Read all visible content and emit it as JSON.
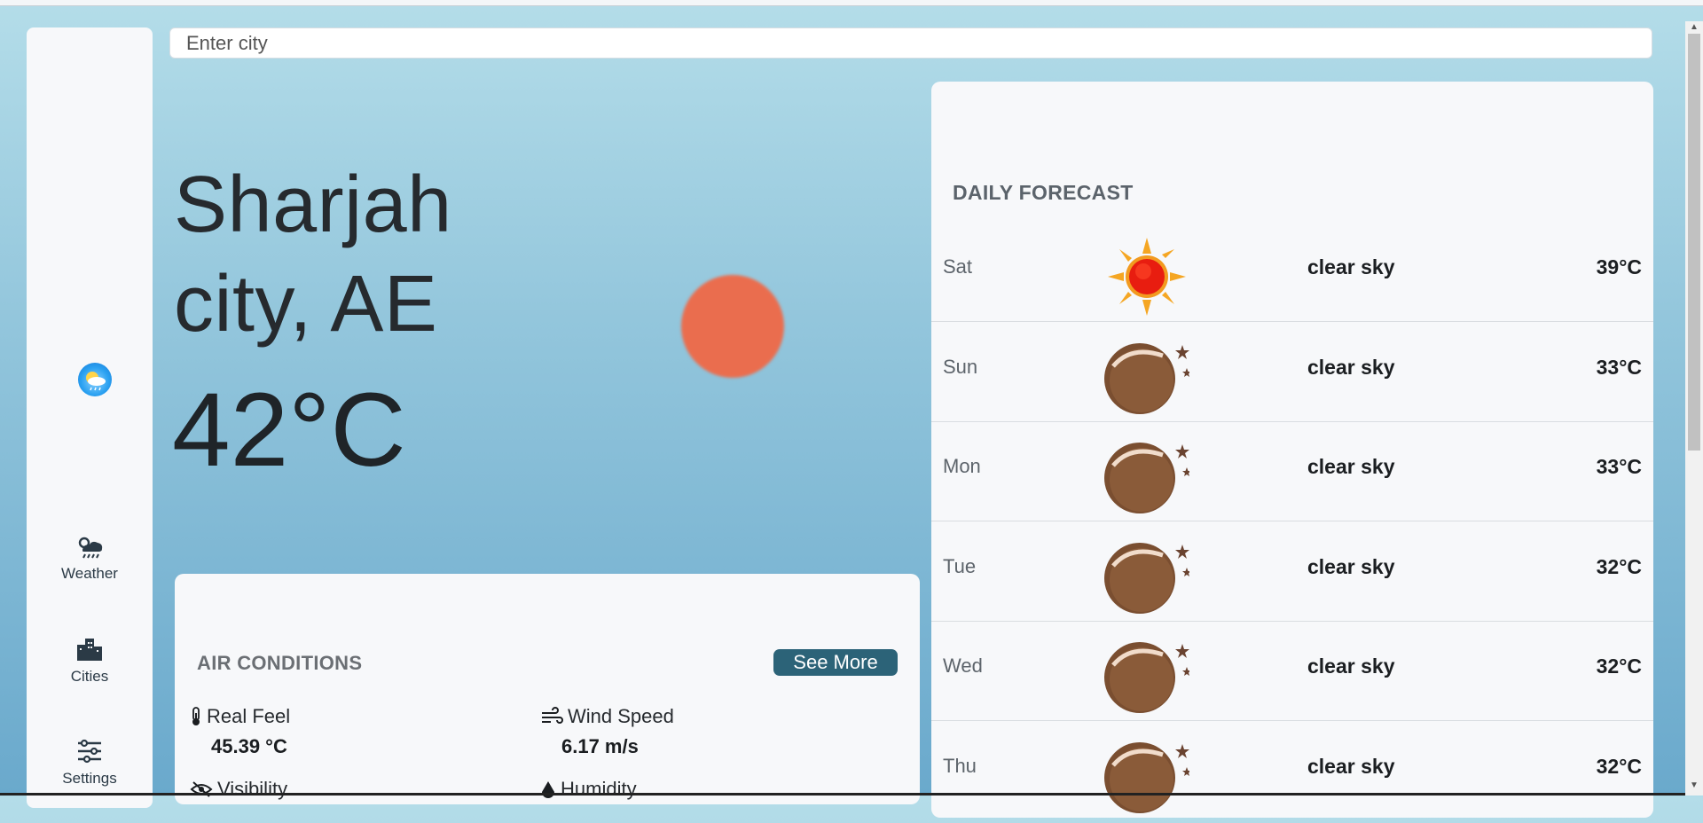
{
  "search": {
    "placeholder": "Enter city"
  },
  "current": {
    "city_line1": "Sharjah",
    "city_line2": "city, AE",
    "temperature": "42°C"
  },
  "sidebar": {
    "items": [
      {
        "label": "Weather",
        "icon": "weather-icon"
      },
      {
        "label": "Cities",
        "icon": "cities-icon"
      },
      {
        "label": "Settings",
        "icon": "settings-icon"
      }
    ]
  },
  "air": {
    "title": "AIR CONDITIONS",
    "see_more": "See More",
    "metrics": [
      {
        "label": "Real Feel",
        "value": "45.39 °C",
        "icon": "thermometer-icon"
      },
      {
        "label": "Wind Speed",
        "value": "6.17 m/s",
        "icon": "wind-icon"
      },
      {
        "label": "Visibility",
        "icon": "visibility-icon"
      },
      {
        "label": "Humidity",
        "icon": "humidity-icon"
      }
    ]
  },
  "forecast": {
    "title": "DAILY FORECAST",
    "days": [
      {
        "day": "Sat",
        "desc": "clear sky",
        "temp": "39°C",
        "icon": "sun-icon"
      },
      {
        "day": "Sun",
        "desc": "clear sky",
        "temp": "33°C",
        "icon": "moon-icon"
      },
      {
        "day": "Mon",
        "desc": "clear sky",
        "temp": "33°C",
        "icon": "moon-icon"
      },
      {
        "day": "Tue",
        "desc": "clear sky",
        "temp": "32°C",
        "icon": "moon-icon"
      },
      {
        "day": "Wed",
        "desc": "clear sky",
        "temp": "32°C",
        "icon": "moon-icon"
      },
      {
        "day": "Thu",
        "desc": "clear sky",
        "temp": "32°C",
        "icon": "moon-icon"
      }
    ]
  },
  "colors": {
    "accent": "#2c6378",
    "sun_blob": "#ea6d4e",
    "card": "#f7f8fa"
  }
}
